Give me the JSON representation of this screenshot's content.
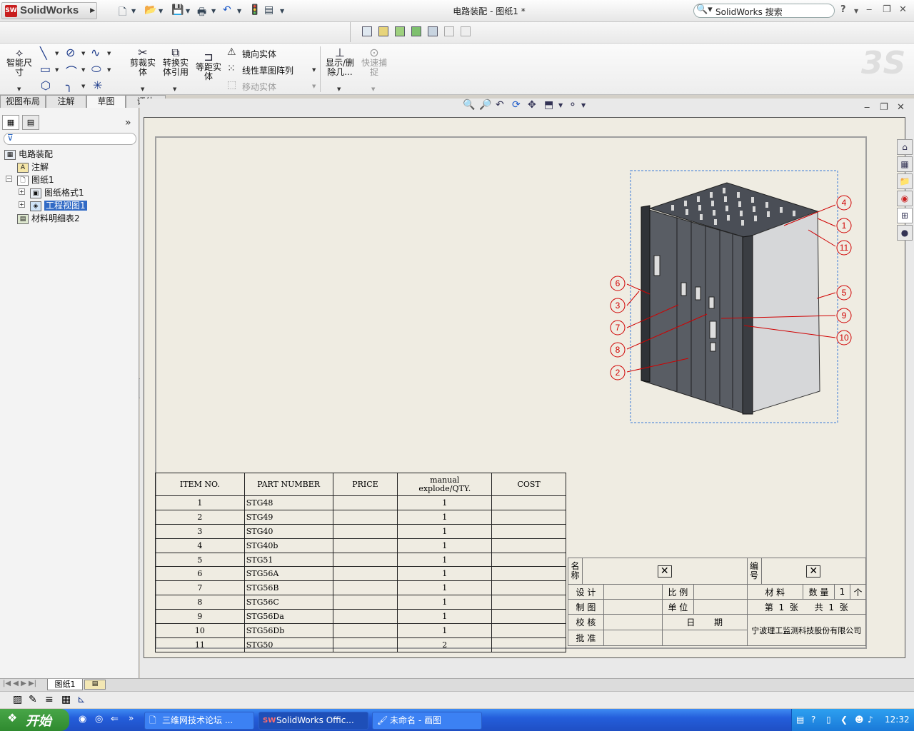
{
  "titlebar": {
    "logo_text": "SolidWorks",
    "logo_badge": "SW",
    "window_title": "电路装配 - 图纸1 *",
    "search_placeholder": "SolidWorks 搜索",
    "help": "?",
    "controls": {
      "minimize": "‒",
      "restore": "❐",
      "close": "✕"
    }
  },
  "command_manager": {
    "smart_dimension": "智能尺寸",
    "trim": "剪裁实体",
    "convert": "转换实体引用",
    "offset": "等距实体",
    "mirror": "镜向实体",
    "linear_pattern": "线性草图阵列",
    "move": "移动实体",
    "show_delete": "显示/删除几...",
    "quick_snap": "快速捕捉"
  },
  "tabs": [
    {
      "label": "视图布局",
      "active": false
    },
    {
      "label": "注解",
      "active": false
    },
    {
      "label": "草图",
      "active": true
    },
    {
      "label": "评估",
      "active": false
    }
  ],
  "tree": {
    "root": "电路装配",
    "annotations": "注解",
    "sheet": "图纸1",
    "sheet_format": "图纸格式1",
    "drawing_view": "工程视图1",
    "bom": "材料明细表2"
  },
  "bom": {
    "headers": [
      "ITEM NO.",
      "PART NUMBER",
      "PRICE",
      "manual\nexplode/QTY.",
      "COST"
    ],
    "rows": [
      {
        "item": "1",
        "part": "STG48",
        "price": "",
        "qty": "1",
        "cost": ""
      },
      {
        "item": "2",
        "part": "STG49",
        "price": "",
        "qty": "1",
        "cost": ""
      },
      {
        "item": "3",
        "part": "STG40",
        "price": "",
        "qty": "1",
        "cost": ""
      },
      {
        "item": "4",
        "part": "STG40b",
        "price": "",
        "qty": "1",
        "cost": ""
      },
      {
        "item": "5",
        "part": "STG51",
        "price": "",
        "qty": "1",
        "cost": ""
      },
      {
        "item": "6",
        "part": "STG56A",
        "price": "",
        "qty": "1",
        "cost": ""
      },
      {
        "item": "7",
        "part": "STG56B",
        "price": "",
        "qty": "1",
        "cost": ""
      },
      {
        "item": "8",
        "part": "STG56C",
        "price": "",
        "qty": "1",
        "cost": ""
      },
      {
        "item": "9",
        "part": "STG56Da",
        "price": "",
        "qty": "1",
        "cost": ""
      },
      {
        "item": "10",
        "part": "STG56Db",
        "price": "",
        "qty": "1",
        "cost": ""
      },
      {
        "item": "11",
        "part": "STG50",
        "price": "",
        "qty": "2",
        "cost": ""
      }
    ]
  },
  "balloons": [
    "4",
    "1",
    "11",
    "6",
    "3",
    "5",
    "9",
    "7",
    "10",
    "8",
    "2"
  ],
  "title_block": {
    "name": "名称",
    "number": "编号",
    "design": "设 计",
    "scale": "比 例",
    "material": "材 料",
    "quantity": "数 量",
    "qty_value": "1",
    "qty_unit": "个",
    "drawing": "制 图",
    "unit": "单 位",
    "sheet_no_label": "第",
    "sheet_no": "1",
    "sheet_word": "张",
    "total_label": "共",
    "total": "1",
    "total_word": "张",
    "check": "校 核",
    "date": "日",
    "date2": "期",
    "approve": "批 准",
    "company": "宁波理工监测科技股份有限公司"
  },
  "sheet_tab": "图纸1",
  "taskbar": {
    "start": "开始",
    "items": [
      {
        "label": "三维网技术论坛 ...",
        "active": false
      },
      {
        "label": "SolidWorks Offic...",
        "active": true
      },
      {
        "label": "未命名 - 画图",
        "active": false
      }
    ],
    "clock": "12:32"
  }
}
